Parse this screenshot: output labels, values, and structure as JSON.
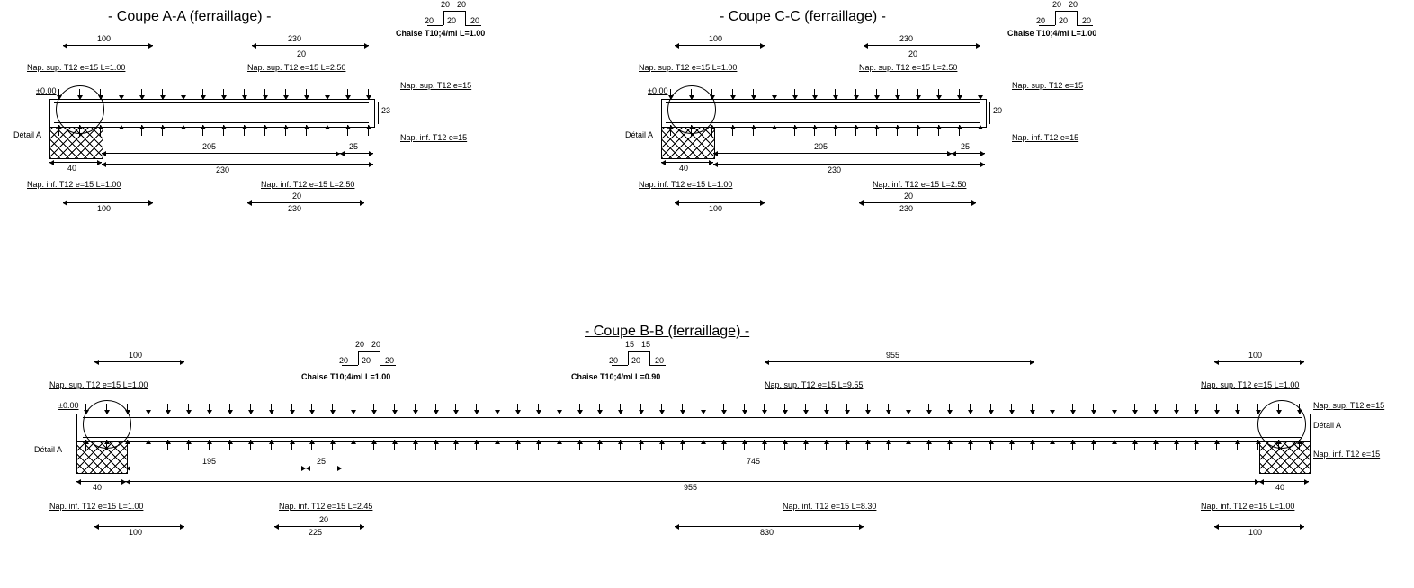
{
  "sectionA": {
    "title": "- Coupe A-A (ferraillage) -",
    "detail": "Détail A",
    "level": "±0.00",
    "chaise_label": "Chaise T10;4/ml L=1.00",
    "nap_sup_label": "Nap. sup. T12 e=15",
    "nap_inf_label": "Nap. inf. T12 e=15",
    "nap_sup_1": "Nap. sup. T12 e=15 L=1.00",
    "nap_sup_2": "Nap. sup. T12 e=15 L=2.50",
    "nap_inf_1": "Nap. inf. T12 e=15 L=1.00",
    "nap_inf_2": "Nap. inf. T12 e=15 L=2.50",
    "dim_100a": "100",
    "dim_230a": "230",
    "dim_40": "40",
    "dim_205": "205",
    "dim_25": "25",
    "dim_230b": "230",
    "dim_100b": "100",
    "dim_230c": "230",
    "dim_20": "20",
    "dim_23": "23",
    "ch20a": "20",
    "ch20b": "20",
    "ch20c": "20",
    "ch20d": "20",
    "ch20e": "20"
  },
  "sectionC": {
    "title": "- Coupe C-C (ferraillage) -",
    "detail": "Détail A",
    "level": "±0.00",
    "chaise_label": "Chaise T10;4/ml L=1.00",
    "nap_sup_label": "Nap. sup. T12 e=15",
    "nap_inf_label": "Nap. inf. T12 e=15",
    "nap_sup_1": "Nap. sup. T12 e=15 L=1.00",
    "nap_sup_2": "Nap. sup. T12 e=15 L=2.50",
    "nap_inf_1": "Nap. inf. T12 e=15 L=1.00",
    "nap_inf_2": "Nap. inf. T12 e=15 L=2.50",
    "dim_100a": "100",
    "dim_230a": "230",
    "dim_40": "40",
    "dim_205": "205",
    "dim_25": "25",
    "dim_230b": "230",
    "dim_100b": "100",
    "dim_230c": "230",
    "dim_20": "20",
    "dim_20r": "20",
    "ch20a": "20",
    "ch20b": "20",
    "ch20c": "20",
    "ch20d": "20",
    "ch20e": "20"
  },
  "sectionB": {
    "title": "- Coupe B-B (ferraillage) -",
    "detail_l": "Détail A",
    "detail_r": "Détail A",
    "level": "±0.00",
    "chaise1_label": "Chaise T10;4/ml L=1.00",
    "chaise2_label": "Chaise T10;4/ml L=0.90",
    "nap_sup_label": "Nap. sup. T12 e=15",
    "nap_inf_label": "Nap. inf. T12 e=15",
    "nap_sup_1": "Nap. sup. T12 e=15 L=1.00",
    "nap_sup_955": "Nap. sup. T12 e=15 L=9.55",
    "nap_sup_r": "Nap. sup. T12 e=15 L=1.00",
    "nap_inf_1": "Nap. inf. T12 e=15 L=1.00",
    "nap_inf_245": "Nap. inf. T12 e=15 L=2.45",
    "nap_inf_830": "Nap. inf. T12 e=15 L=8.30",
    "nap_inf_r": "Nap. inf. T12 e=15 L=1.00",
    "dim_100a": "100",
    "dim_955a": "955",
    "dim_100c": "100",
    "dim_40l": "40",
    "dim_195": "195",
    "dim_25": "25",
    "dim_745": "745",
    "dim_955b": "955",
    "dim_40r": "40",
    "dim_100b": "100",
    "dim_225": "225",
    "dim_20": "20",
    "dim_830": "830",
    "dim_100d": "100",
    "c1_20a": "20",
    "c1_20b": "20",
    "c1_20c": "20",
    "c1_20d": "20",
    "c1_20e": "20",
    "c2_15a": "15",
    "c2_15b": "15",
    "c2_20a": "20",
    "c2_20b": "20",
    "c2_20c": "20"
  }
}
